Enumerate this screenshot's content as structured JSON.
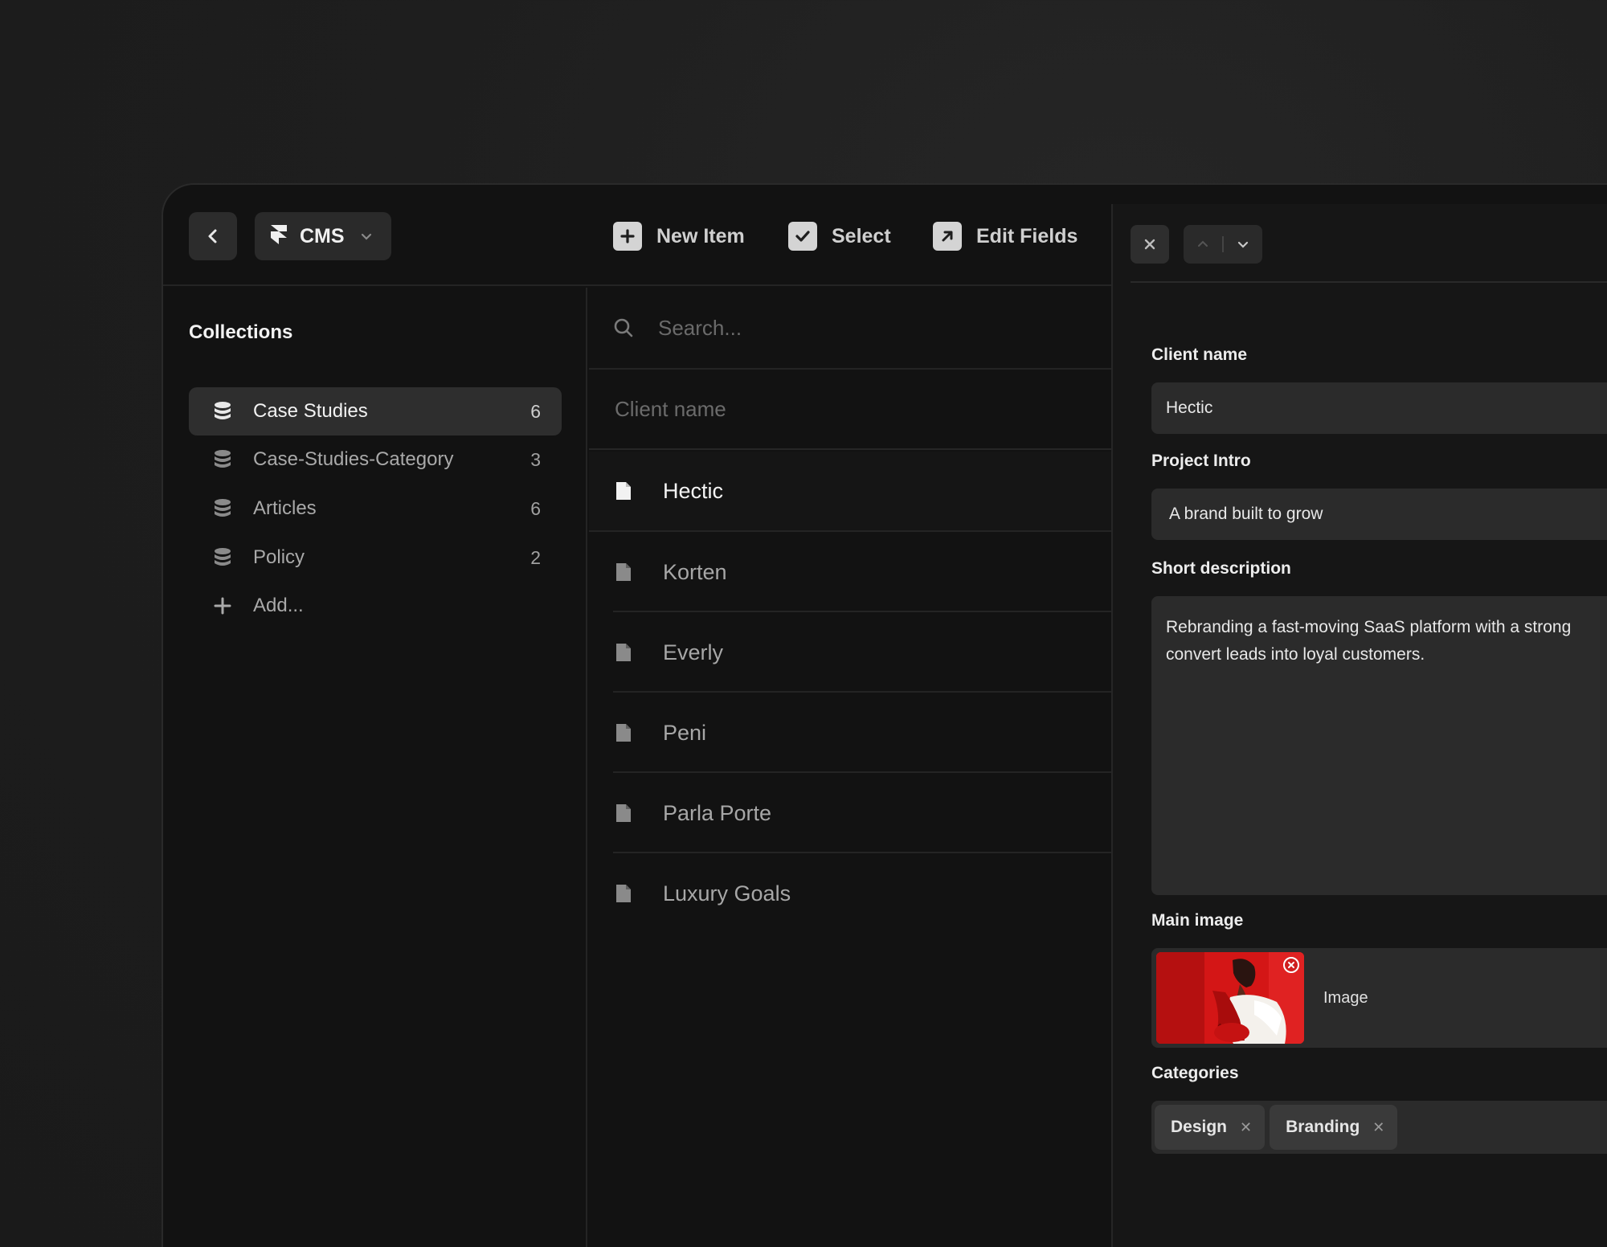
{
  "toolbar": {
    "cms_label": "CMS",
    "new_item_label": "New Item",
    "select_label": "Select",
    "edit_fields_label": "Edit Fields"
  },
  "sidebar": {
    "title": "Collections",
    "items": [
      {
        "label": "Case Studies",
        "count": "6"
      },
      {
        "label": "Case-Studies-Category",
        "count": "3"
      },
      {
        "label": "Articles",
        "count": "6"
      },
      {
        "label": "Policy",
        "count": "2"
      }
    ],
    "add_label": "Add..."
  },
  "list": {
    "search_placeholder": "Search...",
    "column_header": "Client name",
    "rows": [
      "Hectic",
      "Korten",
      "Everly",
      "Peni",
      "Parla Porte",
      "Luxury Goals"
    ]
  },
  "detail": {
    "client_name": {
      "label": "Client name",
      "value": "Hectic"
    },
    "project_intro": {
      "label": "Project Intro",
      "value": "A brand built to grow"
    },
    "short_description": {
      "label": "Short description",
      "line1": "Rebranding a fast-moving SaaS platform with a strong",
      "line2": "convert leads into loyal customers."
    },
    "main_image": {
      "label": "Main image",
      "caption": "Image"
    },
    "categories": {
      "label": "Categories",
      "tags": [
        "Design",
        "Branding"
      ]
    }
  },
  "colors": {
    "background": "#1e1e1e",
    "panel": "#121212",
    "field": "#2b2b2b",
    "thumbnail_red": "#d11a1a"
  }
}
